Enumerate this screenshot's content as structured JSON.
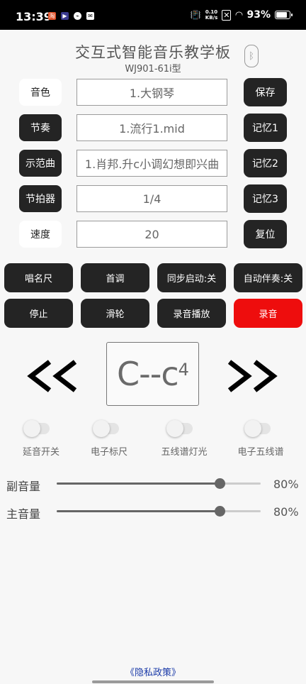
{
  "status_bar": {
    "time": "13:39",
    "net_speed_value": "0.10",
    "net_speed_unit": "KB/s",
    "battery": "93%"
  },
  "header": {
    "title": "交互式智能音乐教学板",
    "model": "WJ901-61i型"
  },
  "settings_rows": [
    {
      "label": "音色",
      "value": "1.大钢琴",
      "button": "保存"
    },
    {
      "label": "节奏",
      "value": "1.流行1.mid",
      "button": "记忆1"
    },
    {
      "label": "示范曲",
      "value": "1.肖邦.升c小调幻想即兴曲",
      "button": "记忆2"
    },
    {
      "label": "节拍器",
      "value": "1/4",
      "button": "记忆3"
    },
    {
      "label": "速度",
      "value": "20",
      "button": "复位"
    }
  ],
  "controls_row1": [
    "唱名尺",
    "首调",
    "同步启动:关",
    "自动伴奏:关"
  ],
  "controls_row2": [
    "停止",
    "滑轮",
    "录音播放",
    "录音"
  ],
  "range_display": {
    "main": "C--c",
    "superscript": "4"
  },
  "toggles": [
    {
      "label": "延音开关",
      "on": false
    },
    {
      "label": "电子标尺",
      "on": false
    },
    {
      "label": "五线谱灯光",
      "on": false
    },
    {
      "label": "电子五线谱",
      "on": false
    }
  ],
  "volume": {
    "secondary_label": "副音量",
    "secondary_value": "80%",
    "secondary_level": 0.8,
    "main_label": "主音量",
    "main_value": "80%",
    "main_level": 0.8
  },
  "privacy_link": "《隐私政策》",
  "colors": {
    "dark_button": "#242424",
    "record_button": "#ee0d0d",
    "link": "#1a3aa8"
  }
}
